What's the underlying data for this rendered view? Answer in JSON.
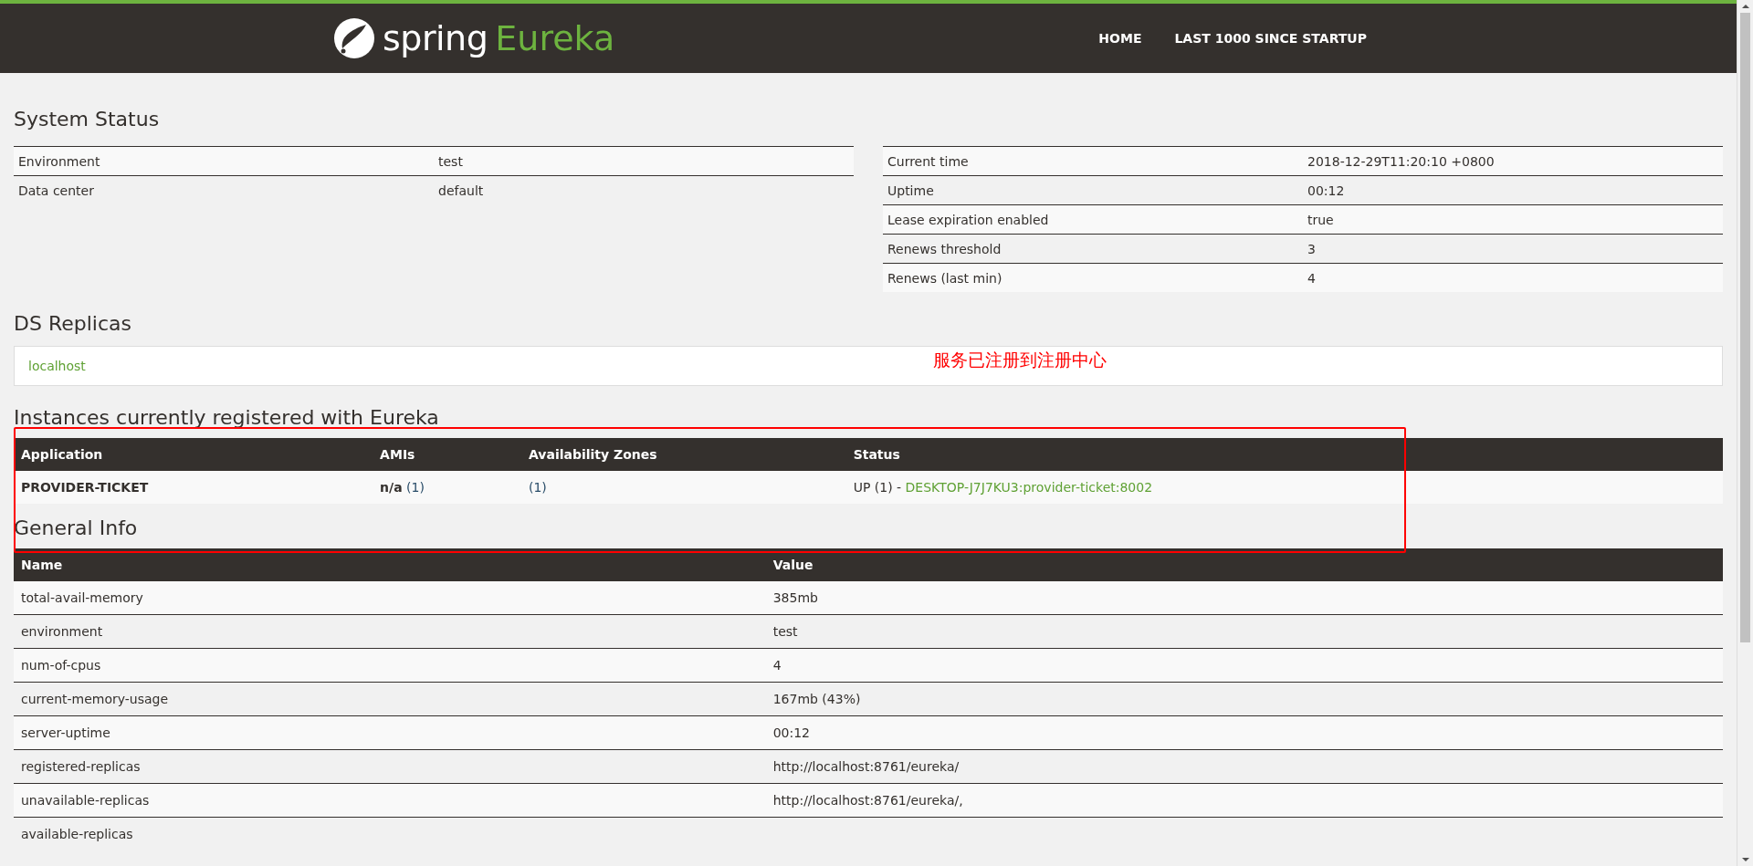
{
  "header": {
    "brand": "spring",
    "product": "Eureka",
    "nav": [
      {
        "label": "HOME"
      },
      {
        "label": "LAST 1000 SINCE STARTUP"
      }
    ]
  },
  "system_status": {
    "title": "System Status",
    "left_rows": [
      {
        "label": "Environment",
        "value": "test"
      },
      {
        "label": "Data center",
        "value": "default"
      }
    ],
    "right_rows": [
      {
        "label": "Current time",
        "value": "2018-12-29T11:20:10 +0800"
      },
      {
        "label": "Uptime",
        "value": "00:12"
      },
      {
        "label": "Lease expiration enabled",
        "value": "true"
      },
      {
        "label": "Renews threshold",
        "value": "3"
      },
      {
        "label": "Renews (last min)",
        "value": "4"
      }
    ]
  },
  "ds_replicas": {
    "title": "DS Replicas",
    "items": [
      "localhost"
    ]
  },
  "instances": {
    "title": "Instances currently registered with Eureka",
    "columns": [
      "Application",
      "AMIs",
      "Availability Zones",
      "Status"
    ],
    "rows": [
      {
        "application": "PROVIDER-TICKET",
        "amis": "n/a",
        "amis_count": "(1)",
        "zones": "(1)",
        "status": "UP (1) -",
        "instance_link": "DESKTOP-J7J7KU3:provider-ticket:8002"
      }
    ]
  },
  "general_info": {
    "title": "General Info",
    "columns": [
      "Name",
      "Value"
    ],
    "rows": [
      {
        "name": "total-avail-memory",
        "value": "385mb"
      },
      {
        "name": "environment",
        "value": "test"
      },
      {
        "name": "num-of-cpus",
        "value": "4"
      },
      {
        "name": "current-memory-usage",
        "value": "167mb (43%)"
      },
      {
        "name": "server-uptime",
        "value": "00:12"
      },
      {
        "name": "registered-replicas",
        "value": "http://localhost:8761/eureka/"
      },
      {
        "name": "unavailable-replicas",
        "value": "http://localhost:8761/eureka/,"
      },
      {
        "name": "available-replicas",
        "value": ""
      }
    ]
  },
  "annotation": {
    "note": "服务已注册到注册中心"
  }
}
